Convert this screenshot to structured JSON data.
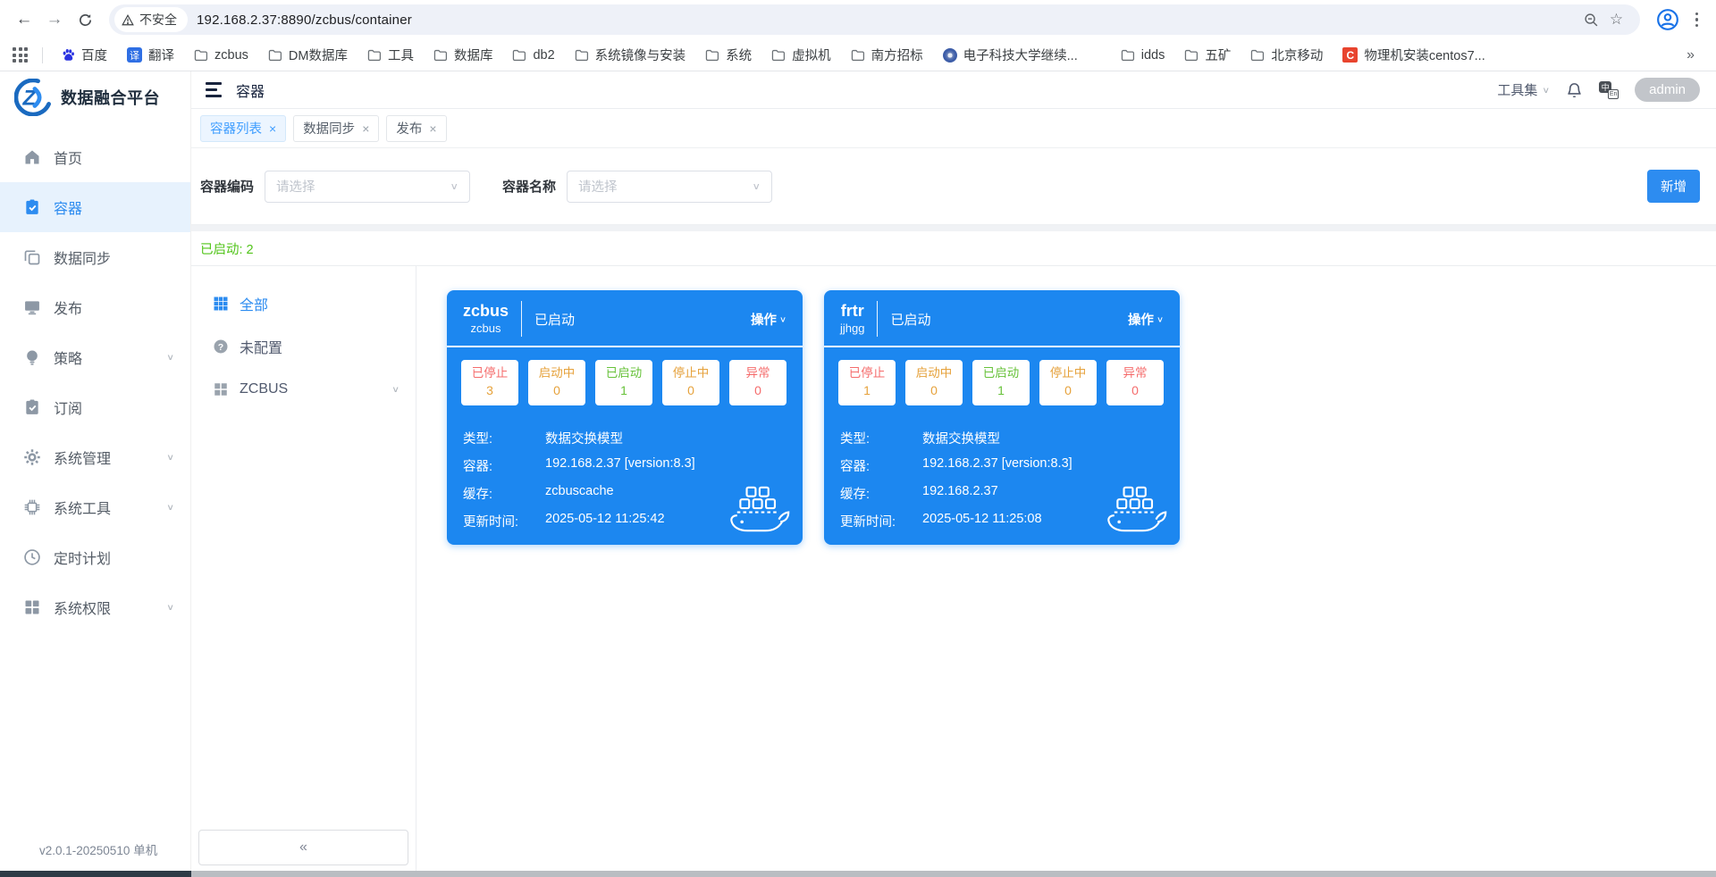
{
  "browser": {
    "security_label": "不安全",
    "url": "192.168.2.37:8890/zcbus/container",
    "overflow": "»",
    "bookmarks": [
      {
        "label": "百度"
      },
      {
        "label": "翻译"
      },
      {
        "label": "zcbus"
      },
      {
        "label": "DM数据库"
      },
      {
        "label": "工具"
      },
      {
        "label": "数据库"
      },
      {
        "label": "db2"
      },
      {
        "label": "系统镜像与安装"
      },
      {
        "label": "系统"
      },
      {
        "label": "虚拟机"
      },
      {
        "label": "南方招标"
      },
      {
        "label": "电子科技大学继续..."
      },
      {
        "label": "idds"
      },
      {
        "label": "五矿"
      },
      {
        "label": "北京移动"
      },
      {
        "label": "物理机安装centos7..."
      }
    ]
  },
  "app": {
    "brand": "数据融合平台",
    "page_title": "容器",
    "header": {
      "toolset": "工具集",
      "user": "admin"
    },
    "sidebar": {
      "items": [
        {
          "label": "首页"
        },
        {
          "label": "容器"
        },
        {
          "label": "数据同步"
        },
        {
          "label": "发布"
        },
        {
          "label": "策略"
        },
        {
          "label": "订阅"
        },
        {
          "label": "系统管理"
        },
        {
          "label": "系统工具"
        },
        {
          "label": "定时计划"
        },
        {
          "label": "系统权限"
        }
      ],
      "version": "v2.0.1-20250510 单机"
    },
    "tabs": [
      {
        "label": "容器列表"
      },
      {
        "label": "数据同步"
      },
      {
        "label": "发布"
      }
    ],
    "filter": {
      "code_label": "容器编码",
      "name_label": "容器名称",
      "placeholder": "请选择",
      "add_button": "新增"
    },
    "summary": "已启动: 2",
    "tree": {
      "all": "全部",
      "unconfigured": "未配置",
      "group": "ZCBUS",
      "collapse": "«"
    },
    "cards": [
      {
        "name": "zcbus",
        "code": "zcbus",
        "status": "已启动",
        "action": "操作",
        "chips": [
          {
            "label": "已停止",
            "value": "3",
            "label_color": "#f56c6c",
            "value_color": "#e6a23c"
          },
          {
            "label": "启动中",
            "value": "0",
            "label_color": "#e6a23c",
            "value_color": "#e6a23c"
          },
          {
            "label": "已启动",
            "value": "1",
            "label_color": "#67c23a",
            "value_color": "#67c23a"
          },
          {
            "label": "停止中",
            "value": "0",
            "label_color": "#e6a23c",
            "value_color": "#e6a23c"
          },
          {
            "label": "异常",
            "value": "0",
            "label_color": "#f56c6c",
            "value_color": "#f56c6c"
          }
        ],
        "rows": [
          {
            "label": "类型:",
            "value": "数据交换模型"
          },
          {
            "label": "容器:",
            "value": "192.168.2.37 [version:8.3]"
          },
          {
            "label": "缓存:",
            "value": "zcbuscache"
          },
          {
            "label": "更新时间:",
            "value": "2025-05-12 11:25:42"
          }
        ]
      },
      {
        "name": "frtr",
        "code": "jjhgg",
        "status": "已启动",
        "action": "操作",
        "chips": [
          {
            "label": "已停止",
            "value": "1",
            "label_color": "#f56c6c",
            "value_color": "#e6a23c"
          },
          {
            "label": "启动中",
            "value": "0",
            "label_color": "#e6a23c",
            "value_color": "#e6a23c"
          },
          {
            "label": "已启动",
            "value": "1",
            "label_color": "#67c23a",
            "value_color": "#67c23a"
          },
          {
            "label": "停止中",
            "value": "0",
            "label_color": "#e6a23c",
            "value_color": "#e6a23c"
          },
          {
            "label": "异常",
            "value": "0",
            "label_color": "#f56c6c",
            "value_color": "#f56c6c"
          }
        ],
        "rows": [
          {
            "label": "类型:",
            "value": "数据交换模型"
          },
          {
            "label": "容器:",
            "value": "192.168.2.37 [version:8.3]"
          },
          {
            "label": "缓存:",
            "value": "192.168.2.37"
          },
          {
            "label": "更新时间:",
            "value": "2025-05-12 11:25:08"
          }
        ]
      }
    ]
  },
  "icons": {
    "chevron_down": "∨",
    "close": "×",
    "star": "☆"
  },
  "colors": {
    "accent": "#2d8cf0",
    "card_blue": "#1c87f0",
    "green": "#52c41a"
  }
}
